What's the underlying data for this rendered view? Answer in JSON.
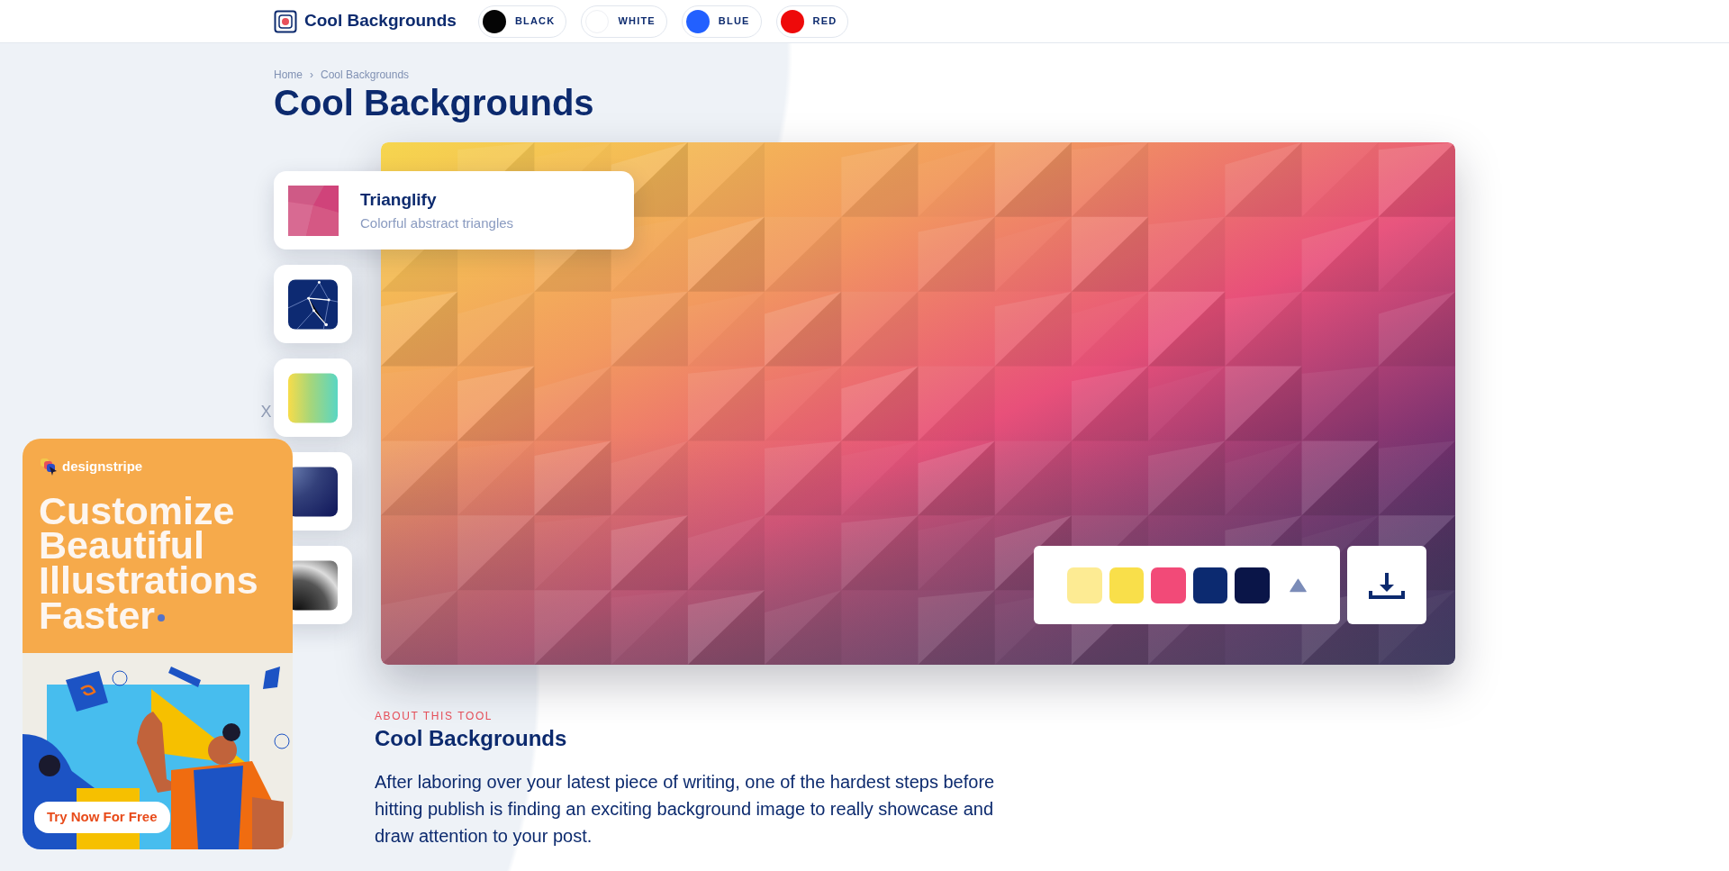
{
  "header": {
    "brand": "Cool Backgrounds",
    "color_chips": [
      {
        "label": "BLACK",
        "color": "#050505"
      },
      {
        "label": "WHITE",
        "color": "#ffffff"
      },
      {
        "label": "BLUE",
        "color": "#2260ff"
      },
      {
        "label": "RED",
        "color": "#ee0a0a"
      }
    ]
  },
  "breadcrumb": {
    "items": [
      "Home",
      "Cool Backgrounds"
    ],
    "separator": "›"
  },
  "page_title": "Cool Backgrounds",
  "tools": [
    {
      "kind": "triangles",
      "selected": true,
      "name": "Trianglify",
      "description": "Colorful abstract triangles"
    },
    {
      "kind": "constellation",
      "selected": false
    },
    {
      "kind": "gradient",
      "selected": false
    },
    {
      "kind": "waves",
      "selected": false
    },
    {
      "kind": "mesh",
      "selected": false
    }
  ],
  "palette": {
    "swatches": [
      {
        "color": "#fdeb93"
      },
      {
        "color": "#f9df4a"
      },
      {
        "color": "#f24a78"
      },
      {
        "color": "#0c2a70"
      },
      {
        "color": "#0a1548"
      }
    ]
  },
  "about": {
    "eyebrow": "ABOUT THIS TOOL",
    "title": "Cool Backgrounds",
    "text": "After laboring over your latest piece of writing, one of the hardest steps before hitting publish is finding an exciting background image to really showcase and draw attention to your post."
  },
  "ad": {
    "close": "X",
    "brand": "designstripe",
    "headline": [
      "Customize",
      "Beautiful",
      "Illustrations",
      "Faster"
    ],
    "cta": "Try Now For Free"
  }
}
